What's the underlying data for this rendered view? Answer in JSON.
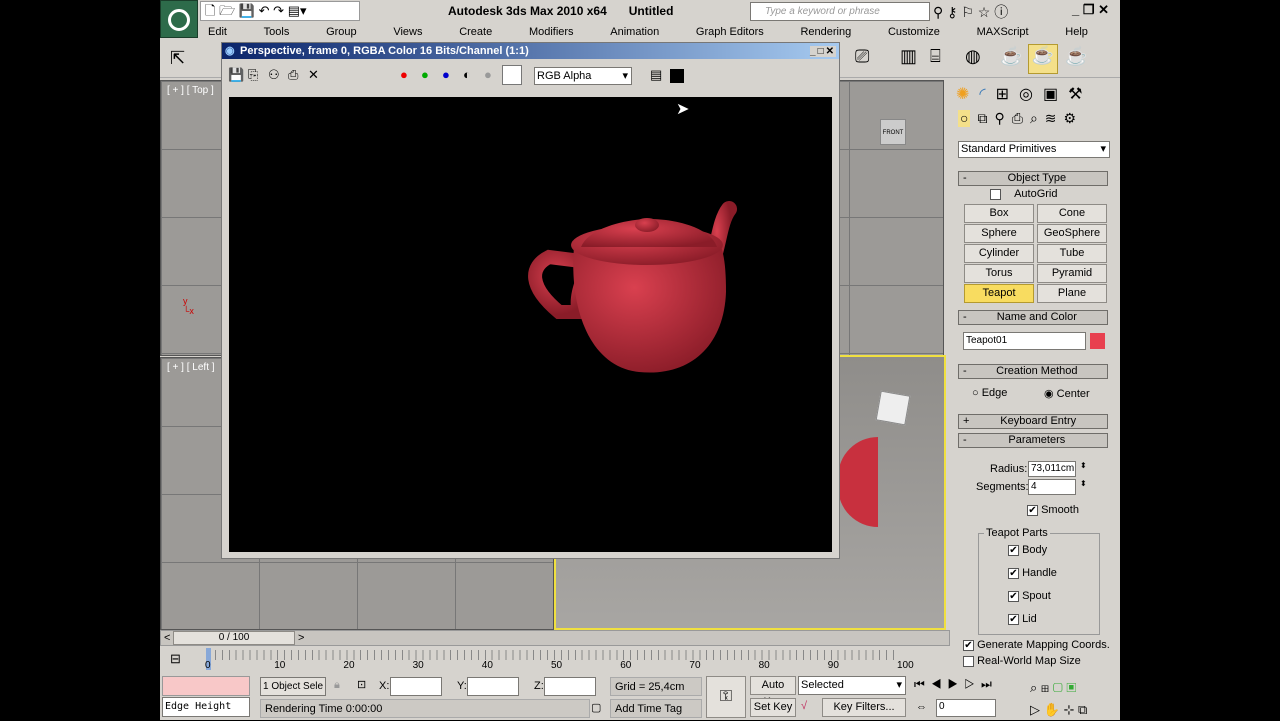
{
  "app": {
    "title": "Autodesk 3ds Max  2010 x64",
    "document": "Untitled",
    "search_placeholder": "Type a keyword or phrase"
  },
  "menu": [
    "Edit",
    "Tools",
    "Group",
    "Views",
    "Create",
    "Modifiers",
    "Animation",
    "Graph Editors",
    "Rendering",
    "Customize",
    "MAXScript",
    "Help"
  ],
  "viewports": {
    "top": "[ + ] [ Top ]",
    "left": "[ + ] [ Left ]",
    "viewcube_label": "FRONT"
  },
  "render_window": {
    "title": "Perspective, frame 0, RGBA Color 16 Bits/Channel (1:1)",
    "channel": "RGB Alpha",
    "teapot_color": "#d9404f"
  },
  "command_panel": {
    "category": "Standard Primitives",
    "object_type": {
      "header": "Object Type",
      "autogrid": "AutoGrid",
      "buttons": [
        "Box",
        "Cone",
        "Sphere",
        "GeoSphere",
        "Cylinder",
        "Tube",
        "Torus",
        "Pyramid",
        "Teapot",
        "Plane"
      ],
      "active": "Teapot"
    },
    "name_color": {
      "header": "Name and Color",
      "name": "Teapot01",
      "color": "#e8404f"
    },
    "creation_method": {
      "header": "Creation Method",
      "edge": "Edge",
      "center": "Center",
      "selected": "Center"
    },
    "keyboard_entry": "Keyboard Entry",
    "parameters": {
      "header": "Parameters",
      "radius_label": "Radius:",
      "radius": "73,011cm",
      "segments_label": "Segments:",
      "segments": "4",
      "smooth": "Smooth",
      "parts_header": "Teapot Parts",
      "parts": [
        "Body",
        "Handle",
        "Spout",
        "Lid"
      ],
      "gen_mapping": "Generate Mapping Coords.",
      "real_world": "Real-World Map Size"
    }
  },
  "timeline": {
    "frame": "0 / 100",
    "ticks": [
      "0",
      "10",
      "20",
      "30",
      "40",
      "50",
      "60",
      "70",
      "80",
      "90",
      "100"
    ]
  },
  "status": {
    "maxscript_field": "Edge Height",
    "selection": "1 Object Sele",
    "x": "X:",
    "y": "Y:",
    "z": "Z:",
    "grid": "Grid = 25,4cm",
    "rendering_time": "Rendering Time  0:00:00",
    "add_time_tag": "Add Time Tag",
    "auto_key": "Auto Key",
    "set_key": "Set Key",
    "key_mode": "Selected",
    "key_filters": "Key Filters...",
    "current_frame": "0"
  }
}
